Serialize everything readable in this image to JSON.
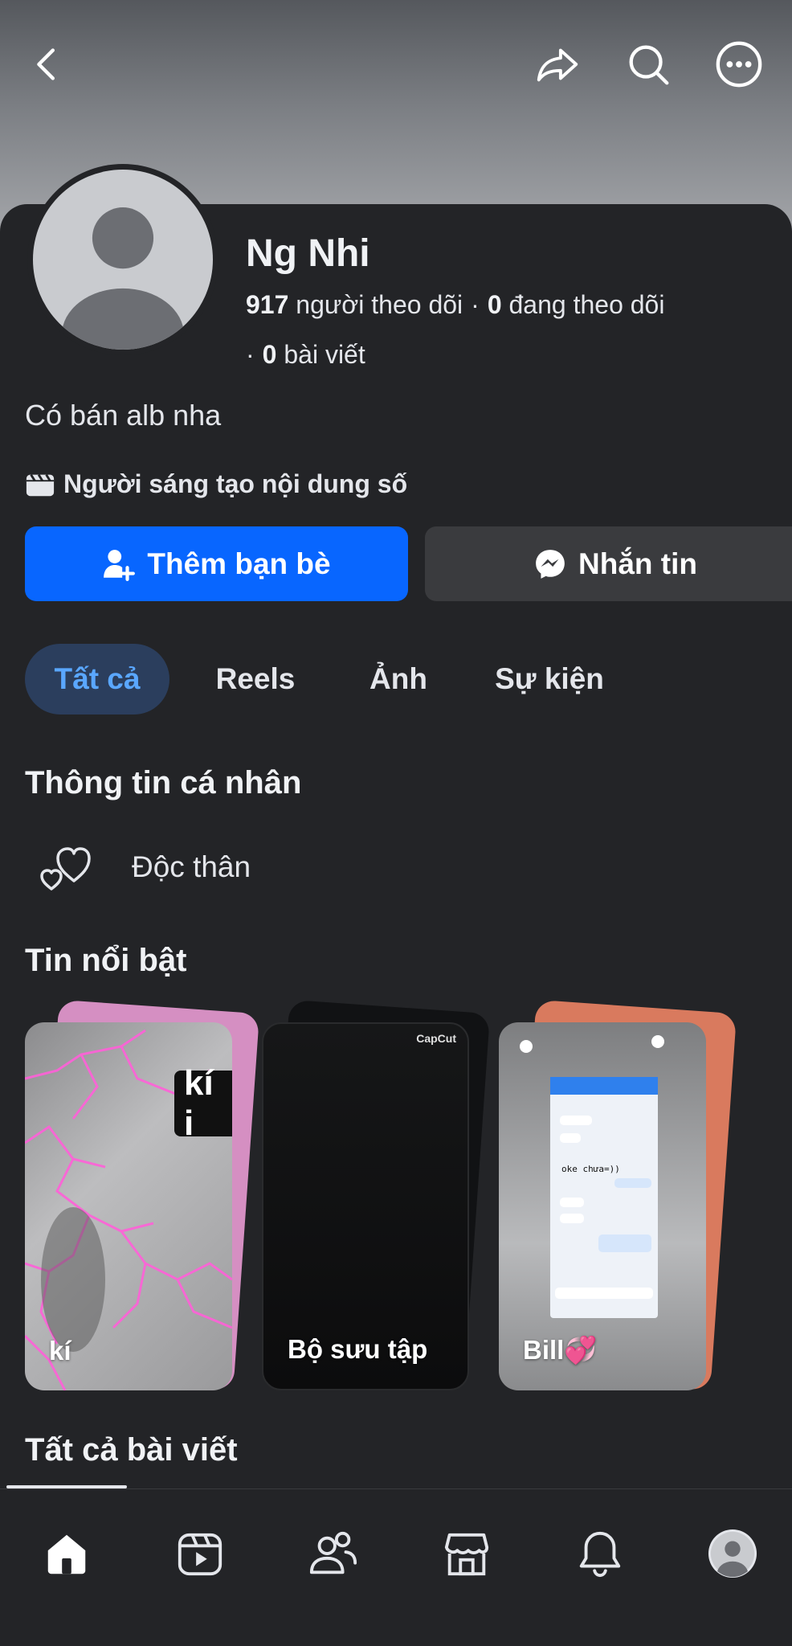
{
  "profile": {
    "name": "Ng Nhi",
    "followers_count": "917",
    "followers_label": "người theo dõi",
    "following_count": "0",
    "following_label": "đang theo dõi",
    "posts_count": "0",
    "posts_label": "bài viết",
    "bio": "Có bán alb nha",
    "category": "Người sáng tạo nội dung số"
  },
  "actions": {
    "add_friend": "Thêm bạn bè",
    "message": "Nhắn tin"
  },
  "tabs": [
    {
      "label": "Tất cả",
      "active": true
    },
    {
      "label": "Reels",
      "active": false
    },
    {
      "label": "Ảnh",
      "active": false
    },
    {
      "label": "Sự kiện",
      "active": false
    }
  ],
  "personal_info": {
    "title": "Thông tin cá nhân",
    "relationship": "Độc thân",
    "relationship_icon": "hearts-icon"
  },
  "highlights": {
    "title": "Tin nổi bật",
    "items": [
      {
        "label": "kí",
        "overlay_text": "kí i"
      },
      {
        "label": "Bộ sưu tập",
        "watermark": "CapCut"
      },
      {
        "label": "Bill",
        "emoji": "💞",
        "chat_text": "oke chưa=))"
      }
    ]
  },
  "posts": {
    "title": "Tất cả bài viết"
  },
  "colors": {
    "background": "#232427",
    "primary": "#0866ff",
    "secondary_button": "#3a3b3e",
    "active_tab_bg": "#2b3e5d",
    "active_tab_text": "#5aa7ff"
  },
  "icons": {
    "top_bar": [
      "back-arrow-icon",
      "share-icon",
      "search-icon",
      "more-icon"
    ],
    "bottom_nav": [
      "home-icon",
      "video-icon",
      "friends-icon",
      "marketplace-icon",
      "notifications-icon",
      "profile-avatar-icon"
    ]
  }
}
